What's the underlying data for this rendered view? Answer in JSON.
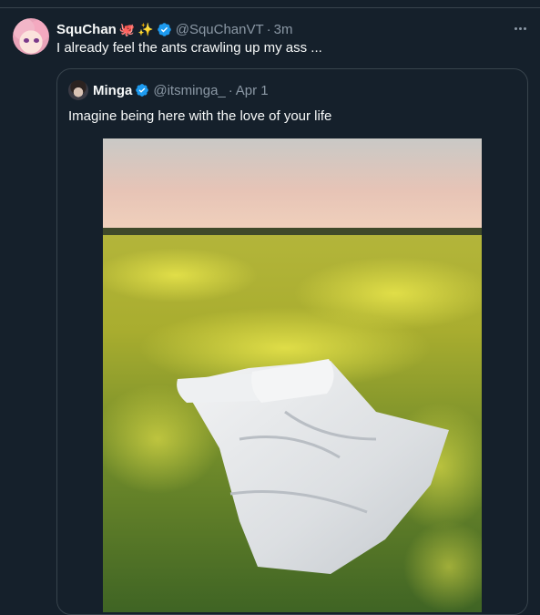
{
  "tweet": {
    "display_name": "SquChan",
    "name_emojis": [
      "octopus-emoji",
      "sparkles-emoji"
    ],
    "emoji_glyphs": {
      "octopus": "🐙",
      "sparkles": "✨"
    },
    "handle": "@SquChanVT",
    "separator": "·",
    "time": "3m",
    "text": "I already feel the ants crawling up my ass ...",
    "verified": true
  },
  "quote": {
    "display_name": "Minga",
    "handle": "@itsminga_",
    "separator": "·",
    "time": "Apr 1",
    "text": "Imagine being here with the love of your life",
    "verified": true,
    "image_description_name": "bed-in-flower-field-photo"
  },
  "colors": {
    "background": "#15202b",
    "border": "#38444d",
    "text_primary": "#f7f9f9",
    "text_secondary": "#8b98a5",
    "verified_blue": "#1d9bf0"
  }
}
